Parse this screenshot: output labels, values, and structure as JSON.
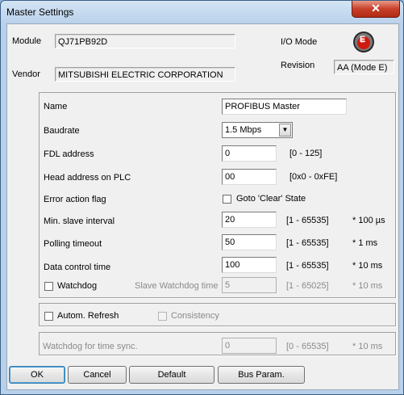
{
  "window": {
    "title": "Master Settings",
    "close_symbol": "✕"
  },
  "header": {
    "module_label": "Module",
    "module_value": "QJ71PB92D",
    "vendor_label": "Vendor",
    "vendor_value": "MITSUBISHI ELECTRIC CORPORATION",
    "io_mode_label": "I/O Mode",
    "io_mode_icon_letter": "E",
    "revision_label": "Revision",
    "revision_value": "AA (Mode E)"
  },
  "params": {
    "name_label": "Name",
    "name_value": "PROFIBUS Master",
    "baudrate_label": "Baudrate",
    "baudrate_value": "1.5 Mbps",
    "fdl_label": "FDL address",
    "fdl_value": "0",
    "fdl_range": "[0 - 125]",
    "head_label": "Head address on PLC",
    "head_value": "00",
    "head_range": "[0x0 - 0xFE]",
    "error_label": "Error action flag",
    "error_checkbox_label": "Goto 'Clear' State",
    "min_slave_label": "Min. slave interval",
    "min_slave_value": "20",
    "min_slave_range": "[1 - 65535]",
    "min_slave_unit": "* 100 µs",
    "polling_label": "Polling timeout",
    "polling_value": "50",
    "polling_range": "[1 - 65535]",
    "polling_unit": "* 1 ms",
    "data_control_label": "Data control time",
    "data_control_value": "100",
    "data_control_range": "[1 - 65535]",
    "data_control_unit": "* 10 ms",
    "watchdog_label": "Watchdog",
    "slave_watchdog_label": "Slave Watchdog time",
    "slave_watchdog_value": "5",
    "slave_watchdog_range": "[1 - 65025]",
    "slave_watchdog_unit": "* 10 ms"
  },
  "refresh": {
    "autom_label": "Autom. Refresh",
    "consistency_label": "Consistency"
  },
  "sync": {
    "label": "Watchdog for time sync.",
    "value": "0",
    "range": "[0 - 65535]",
    "unit": "* 10 ms"
  },
  "buttons": {
    "ok": "OK",
    "cancel": "Cancel",
    "default": "Default",
    "bus_param": "Bus Param."
  }
}
